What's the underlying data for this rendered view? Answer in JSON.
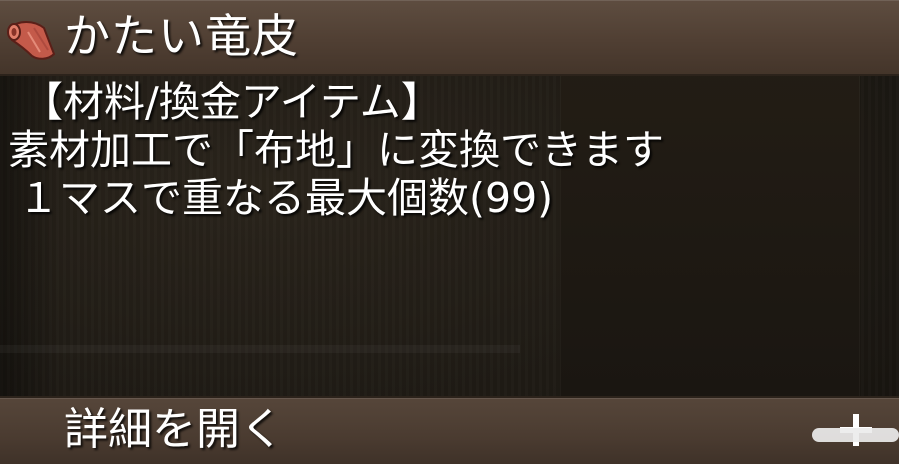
{
  "item": {
    "name": "かたい竜皮",
    "icon": "rolled-leather-icon"
  },
  "description": {
    "category": "【材料/換金アイテム】",
    "line2": "素材加工で「布地」に変換できます",
    "line3": "１マスで重なる最大個数(99)"
  },
  "footer": {
    "detail_label": "詳細を開く",
    "expand_icon": "plus-icon"
  },
  "colors": {
    "title_bar": "#503f33",
    "footer_bar": "#4a3b30",
    "text": "#ffffff",
    "icon_leather": "#c45a4a"
  }
}
